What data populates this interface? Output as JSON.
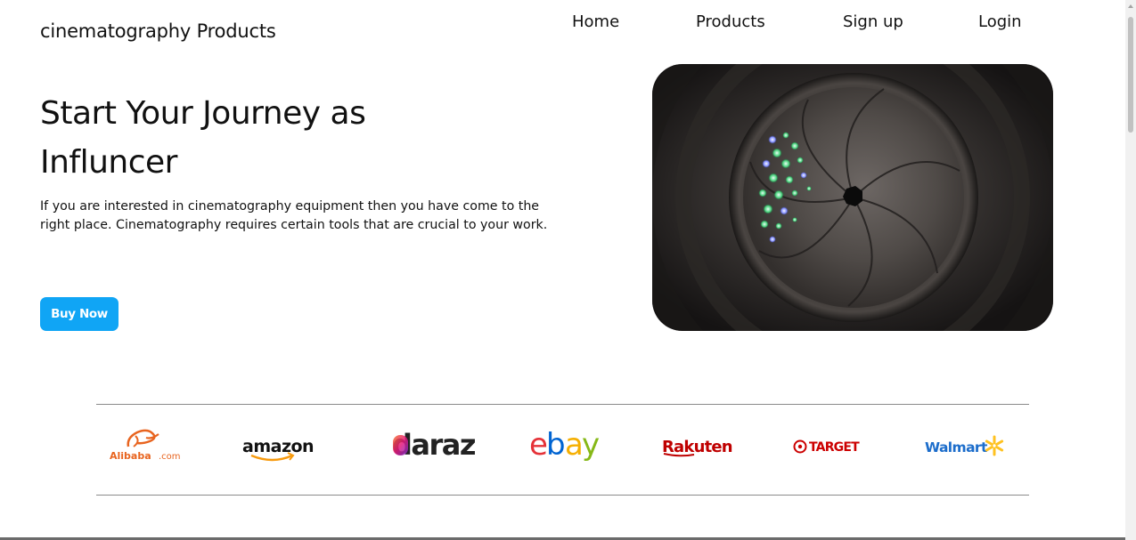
{
  "header": {
    "brand": "cinematography Products",
    "nav": [
      {
        "label": "Home"
      },
      {
        "label": "Products"
      },
      {
        "label": "Sign up"
      },
      {
        "label": "Login"
      }
    ]
  },
  "hero": {
    "title_line1": "Start Your Journey as",
    "title_line2": "Influncer",
    "description": "If you are interested in cinematography equipment then you have come to the right place. Cinematography requires certain tools that are crucial to your work.",
    "cta_label": "Buy Now",
    "image_subject": "camera-lens-aperture"
  },
  "partners": {
    "alibaba": {
      "name": "Alibaba",
      "suffix": ".com"
    },
    "amazon": {
      "name": "amazon"
    },
    "daraz": {
      "name": "daraz"
    },
    "ebay": {
      "name": "ebay"
    },
    "rakuten": {
      "name": "Rakuten"
    },
    "target": {
      "name": "TARGET"
    },
    "walmart": {
      "name": "Walmart"
    }
  },
  "colors": {
    "accent": "#10a5f5",
    "alibaba": "#e8641f",
    "amazon_arrow": "#f79a0e",
    "rakuten": "#bf0000",
    "target": "#cc0000",
    "walmart_blue": "#1c6dcb",
    "walmart_yellow": "#ffc220"
  }
}
